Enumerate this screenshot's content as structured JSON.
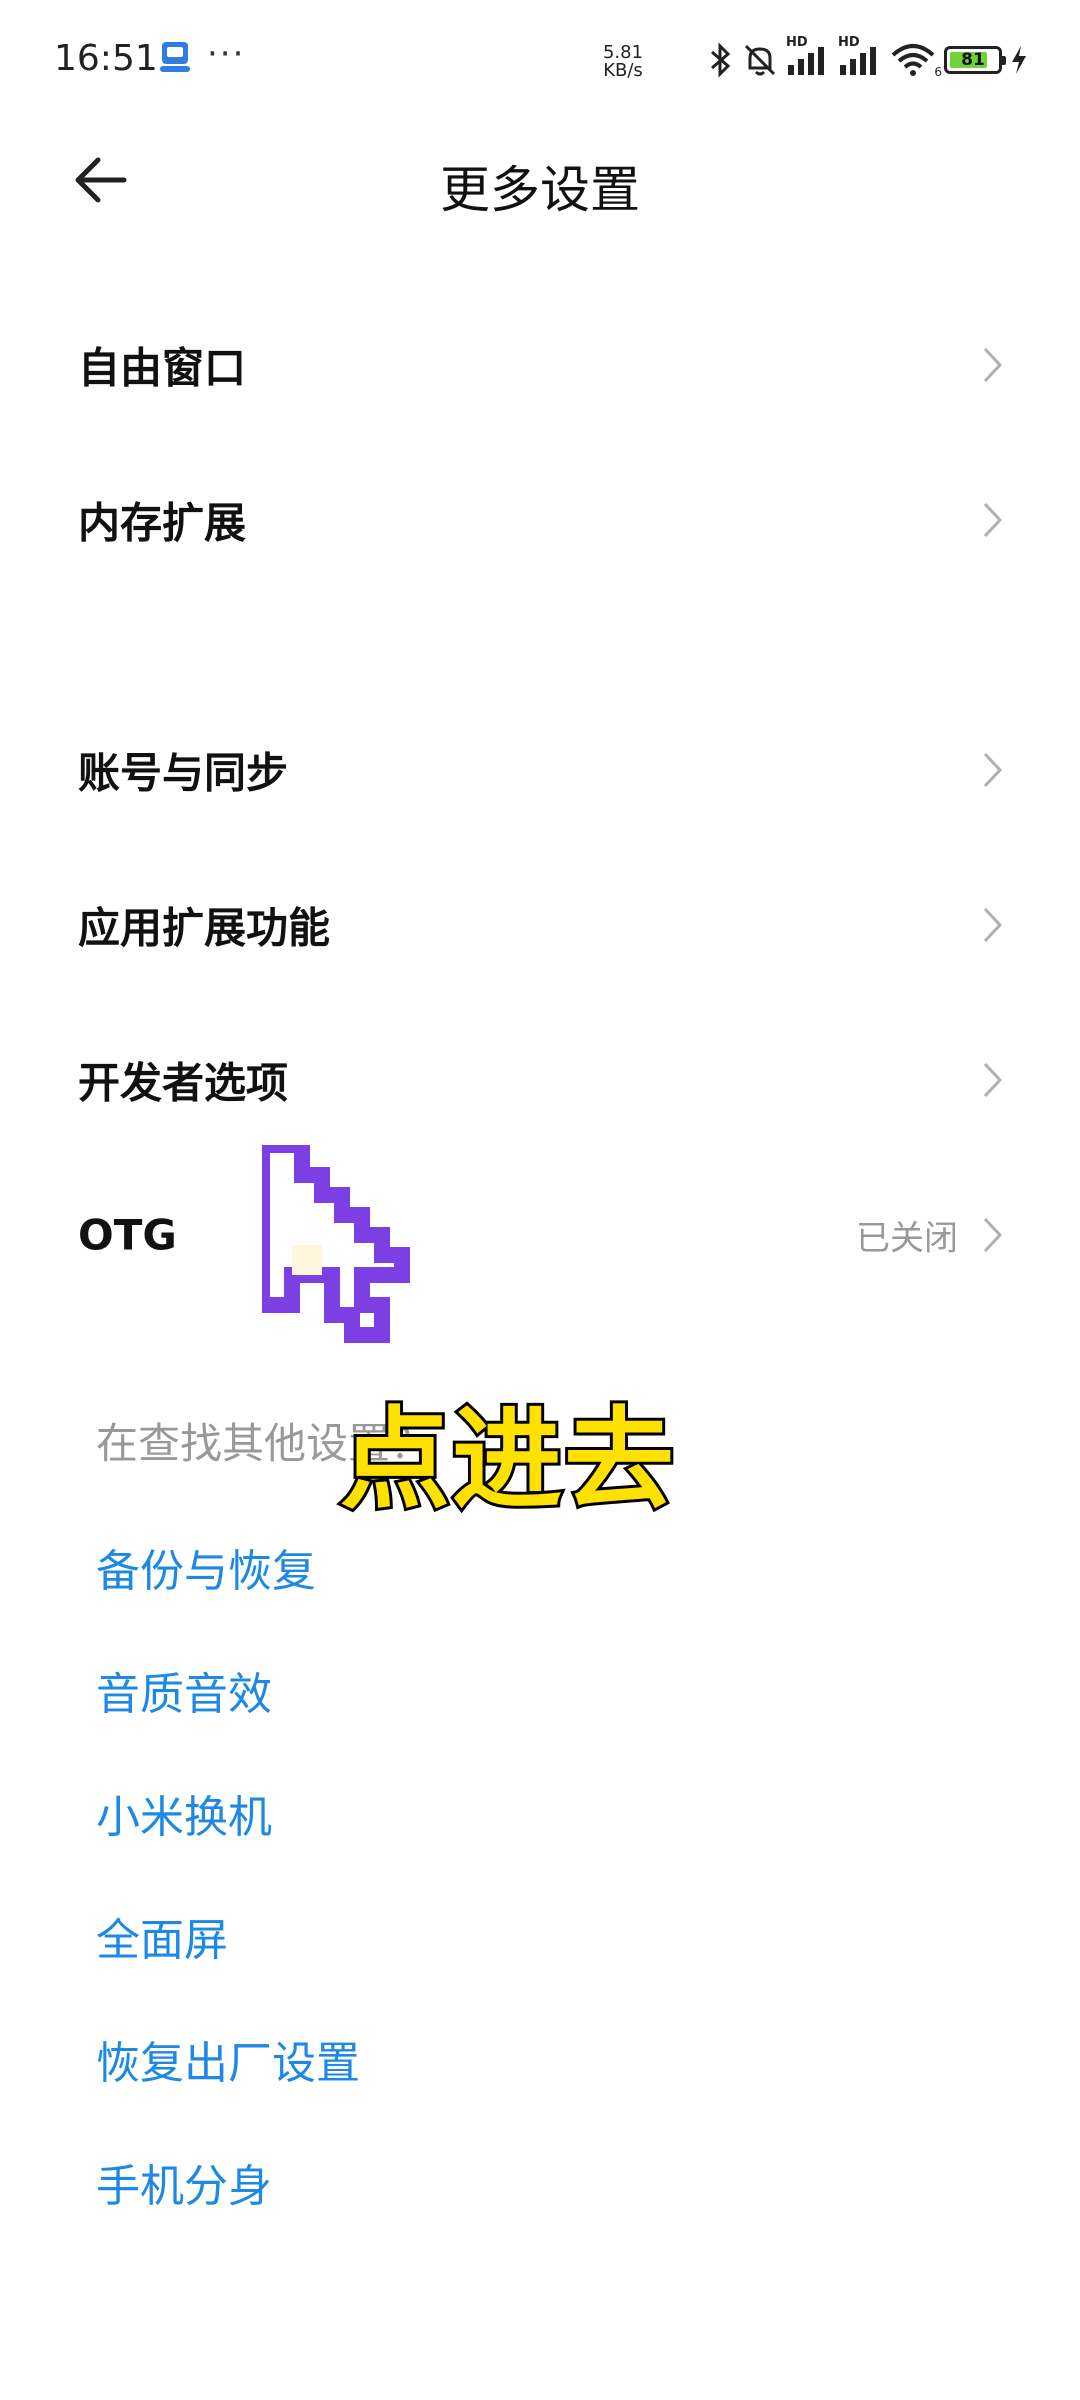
{
  "status_bar": {
    "time": "16:51",
    "more_indicator": "···",
    "net_speed_value": "5.81",
    "net_speed_unit": "KB/s",
    "signal_label_1": "HD",
    "signal_label_2": "HD",
    "wifi_label": "6",
    "battery_level": "81",
    "battery_fraction": 0.81,
    "battery_color": "#6fd23a",
    "icons": [
      "app-notification-icon",
      "bluetooth-icon",
      "silent-bell-icon",
      "signal-icon",
      "signal-icon",
      "wifi-icon",
      "battery-icon",
      "charging-bolt-icon"
    ]
  },
  "header": {
    "back_icon": "arrow-left-icon",
    "title": "更多设置"
  },
  "settings": {
    "items": [
      {
        "label": "自由窗口",
        "value": ""
      },
      {
        "label": "内存扩展",
        "value": ""
      },
      {
        "label": "账号与同步",
        "value": ""
      },
      {
        "label": "应用扩展功能",
        "value": ""
      },
      {
        "label": "开发者选项",
        "value": ""
      },
      {
        "label": "OTG",
        "value": "已关闭"
      }
    ]
  },
  "suggestions": {
    "title": "在查找其他设置？",
    "links": [
      "备份与恢复",
      "音质音效",
      "小米换机",
      "全面屏",
      "恢复出厂设置",
      "手机分身"
    ]
  },
  "overlay": {
    "caption": "点进去",
    "caption_color": "#ffe100",
    "cursor_color": "#7b3fe4"
  }
}
